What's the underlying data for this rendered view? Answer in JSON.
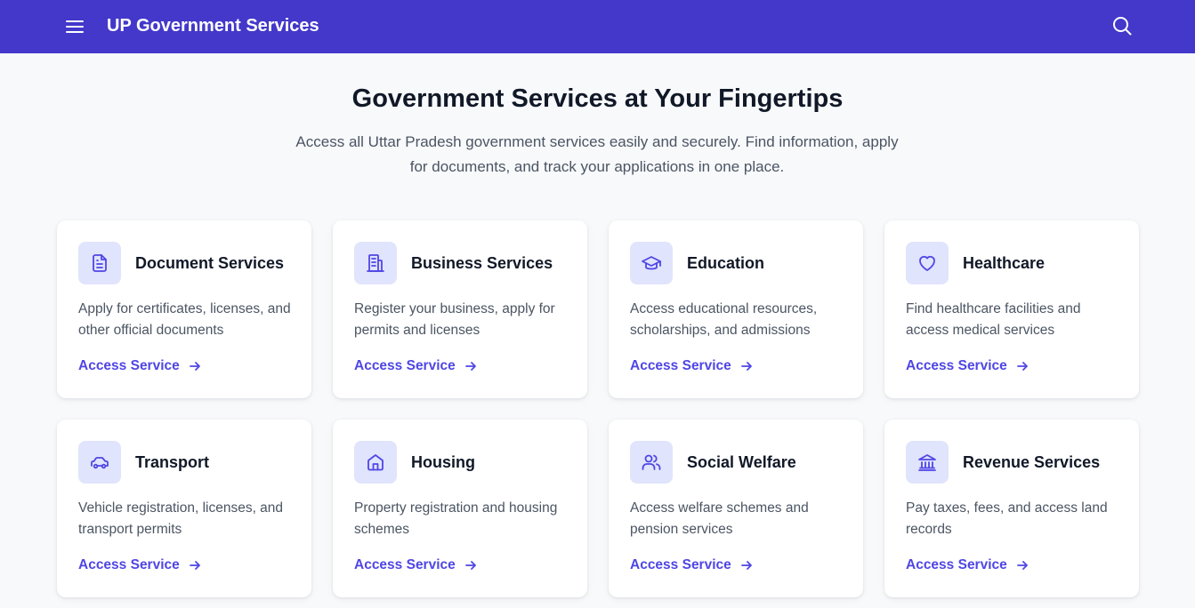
{
  "header": {
    "title": "UP Government Services",
    "menu_icon": "hamburger-menu-icon",
    "search_icon": "search-icon",
    "background": "#4338ca"
  },
  "hero": {
    "title": "Government Services at Your Fingertips",
    "subtitle": "Access all Uttar Pradesh government services easily and securely. Find information, apply for documents, and track your applications in one place."
  },
  "accent_color": "#4f46e5",
  "icon_bg_color": "#e0e4fc",
  "services": [
    {
      "title": "Document Services",
      "description": "Apply for certificates, licenses, and other official documents",
      "link": "Access Service",
      "icon": "document-icon"
    },
    {
      "title": "Business Services",
      "description": "Register your business, apply for permits and licenses",
      "link": "Access Service",
      "icon": "building-icon"
    },
    {
      "title": "Education",
      "description": "Access educational resources, scholarships, and admissions",
      "link": "Access Service",
      "icon": "graduation-cap-icon"
    },
    {
      "title": "Healthcare",
      "description": "Find healthcare facilities and access medical services",
      "link": "Access Service",
      "icon": "heart-icon"
    },
    {
      "title": "Transport",
      "description": "Vehicle registration, licenses, and transport permits",
      "link": "Access Service",
      "icon": "car-icon"
    },
    {
      "title": "Housing",
      "description": "Property registration and housing schemes",
      "link": "Access Service",
      "icon": "home-icon"
    },
    {
      "title": "Social Welfare",
      "description": "Access welfare schemes and pension services",
      "link": "Access Service",
      "icon": "users-icon"
    },
    {
      "title": "Revenue Services",
      "description": "Pay taxes, fees, and access land records",
      "link": "Access Service",
      "icon": "landmark-icon"
    }
  ]
}
